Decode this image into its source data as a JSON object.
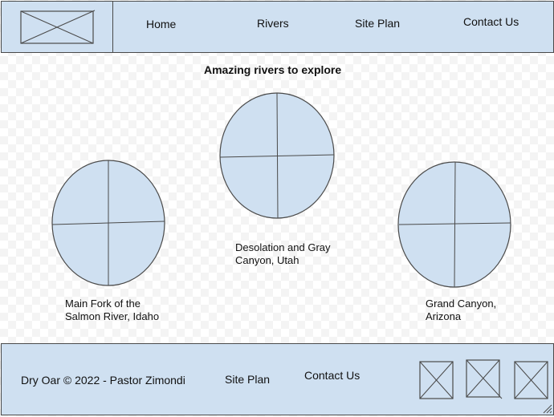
{
  "header": {
    "logo_icon": "image-placeholder-icon",
    "nav": [
      {
        "label": "Home"
      },
      {
        "label": "Rivers"
      },
      {
        "label": "Site Plan"
      },
      {
        "label": "Contact Us"
      }
    ]
  },
  "main": {
    "title": "Amazing rivers to explore",
    "rivers": [
      {
        "label": "Main Fork of the\nSalmon River, Idaho",
        "image_icon": "image-placeholder-icon"
      },
      {
        "label": "Desolation and Gray\nCanyon, Utah",
        "image_icon": "image-placeholder-icon"
      },
      {
        "label": "Grand Canyon,\nArizona",
        "image_icon": "image-placeholder-icon"
      }
    ]
  },
  "footer": {
    "copyright": "Dry Oar © 2022 - Pastor Zimondi",
    "site_plan": "Site Plan",
    "contact": "Contact Us",
    "social_icons": [
      "image-placeholder-icon",
      "image-placeholder-icon",
      "image-placeholder-icon"
    ]
  },
  "colors": {
    "panel_fill": "#cfe0f1",
    "stroke": "#4a4a4a"
  }
}
